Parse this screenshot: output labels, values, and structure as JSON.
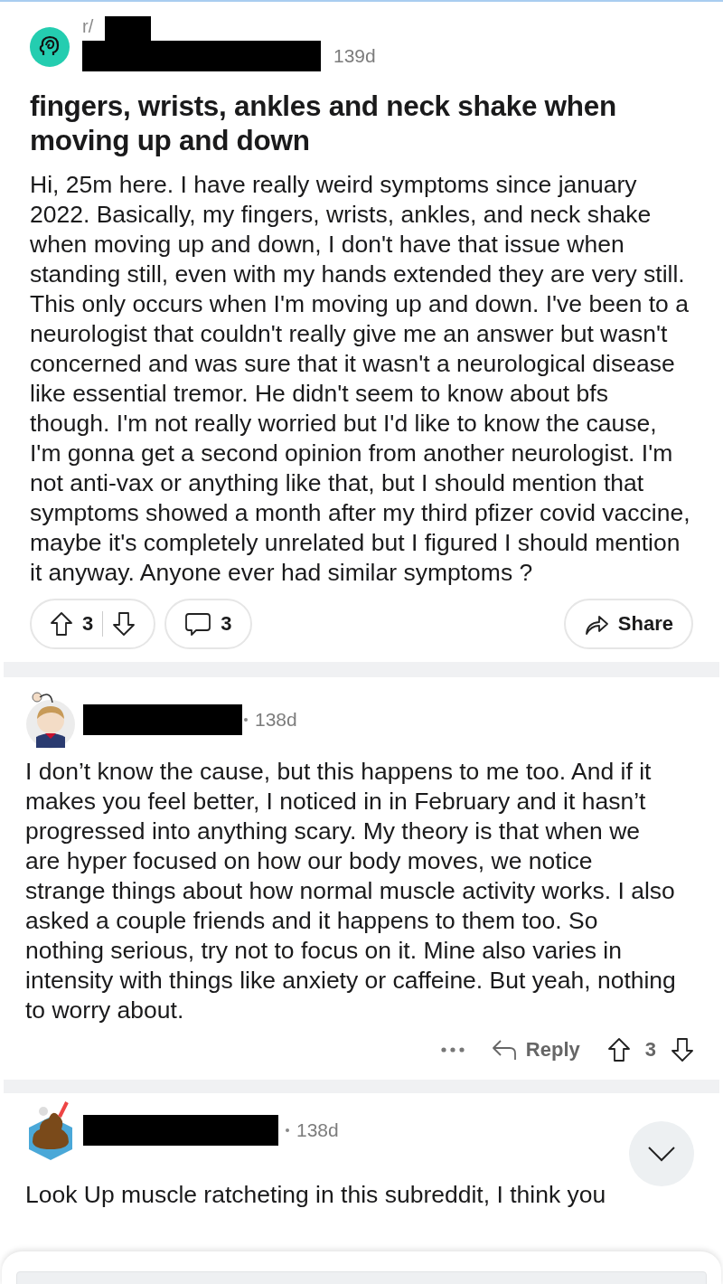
{
  "post": {
    "subreddit": "r/",
    "age": "139d",
    "title": "fingers, wrists, ankles and neck shake when moving up and down",
    "body": "Hi, 25m here. I have really weird symptoms since january 2022. Basically, my fingers, wrists, ankles, and neck shake when moving up and down, I don't have that issue when standing still, even with my hands extended they are very still. This only occurs when I'm moving up and down. I've been to a neurologist that couldn't really give me an answer but wasn't concerned and was sure that it wasn't a neurological disease like essential tremor. He didn't seem to know about bfs though. I'm not really worried but I'd like to know the cause, I'm gonna get a second opinion from another neurologist. I'm not anti-vax or anything like that, but I should mention that symptoms showed a month after my third pfizer covid vaccine, maybe it's completely unrelated but I figured I should mention it anyway. Anyone ever had similar symptoms ?",
    "votes": "3",
    "comments": "3",
    "share": "Share"
  },
  "comments": [
    {
      "kind": "full",
      "age": "138d",
      "body": "I don’t know the cause, but this happens to me too. And if it makes you feel better, I noticed in in February and it hasn’t progressed into anything scary. My theory is that when we are hyper focused on how our body moves, we notice strange things about how normal muscle activity works. I also asked a couple friends and it happens to them too. So nothing serious, try not to focus on it. Mine also varies in intensity with things like anxiety or caffeine. But yeah, nothing to worry about.",
      "reply": "Reply",
      "votes": "3"
    },
    {
      "kind": "partial",
      "age": "138d",
      "body": "Look Up muscle ratcheting in this subreddit, I think you"
    }
  ]
}
